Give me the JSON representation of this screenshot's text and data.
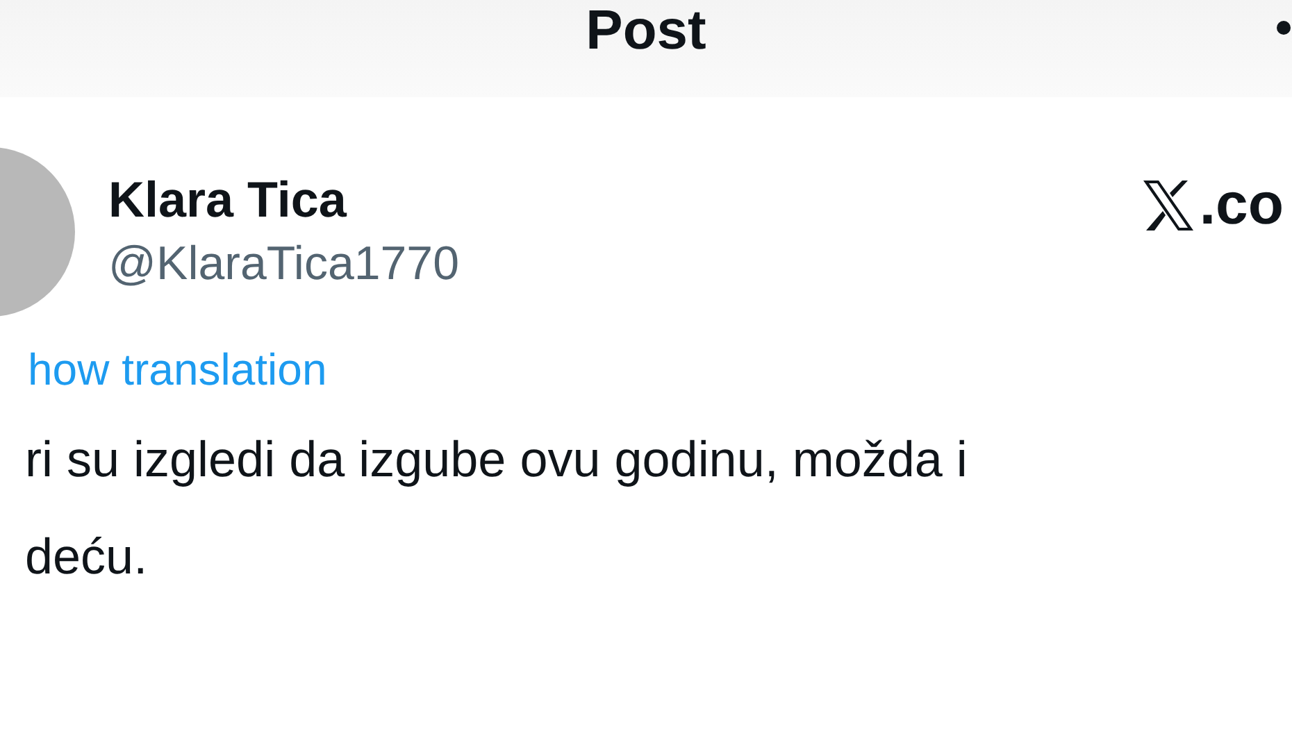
{
  "header": {
    "title": "Post"
  },
  "author": {
    "name": "Klara Tica",
    "handle": "@KlaraTica1770"
  },
  "site": {
    "domain": ".co"
  },
  "translate_link": "how translation",
  "body": [
    "ri su izgledi da izgube ovu godinu, možda i",
    "deću."
  ]
}
